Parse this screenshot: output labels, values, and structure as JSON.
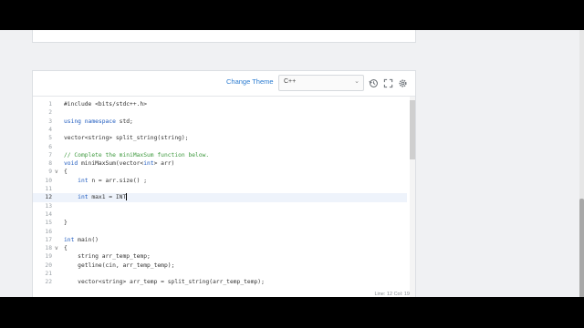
{
  "toolbar": {
    "change_theme": "Change Theme",
    "language": "C++",
    "icons": [
      "history-icon",
      "fullscreen-icon",
      "settings-icon"
    ]
  },
  "code_lines": [
    {
      "n": "1",
      "fold": "",
      "html": "#include <bits/stdc++.h>"
    },
    {
      "n": "2",
      "fold": "",
      "html": ""
    },
    {
      "n": "3",
      "fold": "",
      "html": "using namespace std;"
    },
    {
      "n": "4",
      "fold": "",
      "html": ""
    },
    {
      "n": "5",
      "fold": "",
      "html": "vector<string> split_string(string);"
    },
    {
      "n": "6",
      "fold": "",
      "html": ""
    },
    {
      "n": "7",
      "fold": "",
      "html": "// Complete the miniMaxSum function below."
    },
    {
      "n": "8",
      "fold": "",
      "html": "void miniMaxSum(vector<int> arr)"
    },
    {
      "n": "9",
      "fold": "v",
      "html": "{"
    },
    {
      "n": "10",
      "fold": "",
      "html": "    int n = arr.size() ;"
    },
    {
      "n": "11",
      "fold": "",
      "html": ""
    },
    {
      "n": "12",
      "fold": "",
      "html": "    int max1 = INT"
    },
    {
      "n": "13",
      "fold": "",
      "html": ""
    },
    {
      "n": "14",
      "fold": "",
      "html": ""
    },
    {
      "n": "15",
      "fold": "",
      "html": "}"
    },
    {
      "n": "16",
      "fold": "",
      "html": ""
    },
    {
      "n": "17",
      "fold": "",
      "html": "int main()"
    },
    {
      "n": "18",
      "fold": "v",
      "html": "{"
    },
    {
      "n": "19",
      "fold": "",
      "html": "    string arr_temp_temp;"
    },
    {
      "n": "20",
      "fold": "",
      "html": "    getline(cin, arr_temp_temp);"
    },
    {
      "n": "21",
      "fold": "",
      "html": ""
    },
    {
      "n": "22",
      "fold": "",
      "html": "    vector<string> arr_temp = split_string(arr_temp_temp);"
    }
  ],
  "active_line": "12",
  "status": "Line: 12 Col: 19"
}
